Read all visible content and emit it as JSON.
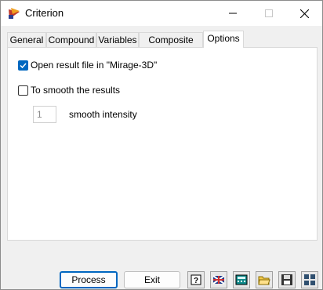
{
  "window": {
    "title": "Criterion"
  },
  "tabs": [
    {
      "label": "General"
    },
    {
      "label": "Compound"
    },
    {
      "label": "Variables"
    },
    {
      "label": "Composite vars"
    },
    {
      "label": "Options",
      "active": true
    }
  ],
  "options": {
    "open_result": {
      "label": "Open result file in \"Mirage-3D\"",
      "checked": true
    },
    "smooth": {
      "label": "To smooth the results",
      "checked": false
    },
    "smooth_intensity": {
      "value": "1",
      "label": "smooth intensity"
    }
  },
  "footer": {
    "process_label": "Process",
    "exit_label": "Exit",
    "icons": [
      "help-book-icon",
      "flag-icon",
      "calculator-icon",
      "open-folder-icon",
      "save-disk-icon",
      "grid-icon"
    ]
  },
  "colors": {
    "accent": "#0067c0"
  }
}
